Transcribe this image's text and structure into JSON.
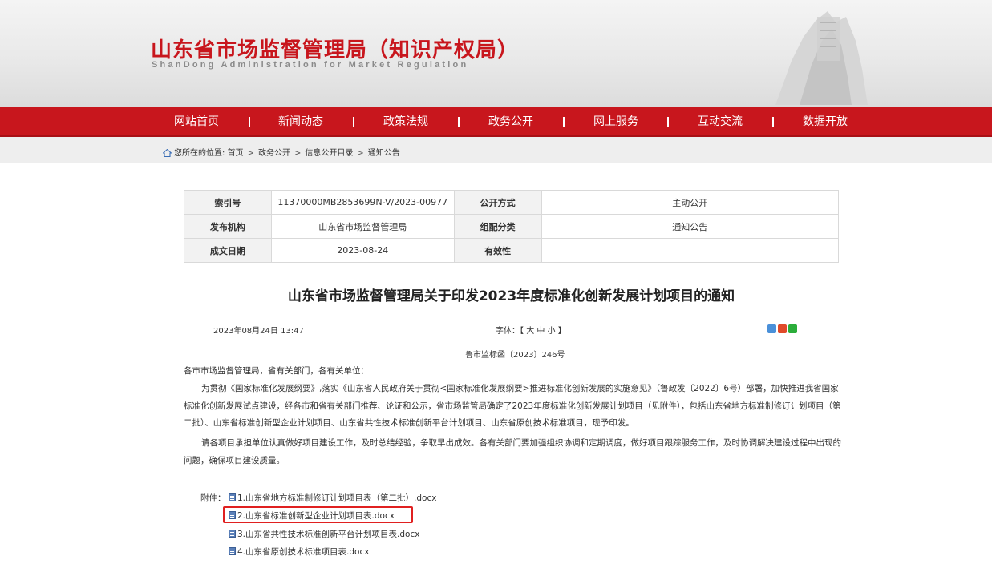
{
  "header": {
    "title": "山东省市场监督管理局（知识产权局）",
    "subtitle": "ShanDong Administration for Market Regulation",
    "brand_color": "#c8161d"
  },
  "nav": {
    "items": [
      "网站首页",
      "新闻动态",
      "政策法规",
      "政务公开",
      "网上服务",
      "互动交流",
      "数据开放"
    ]
  },
  "breadcrumb": {
    "prefix": "您所在的位置:",
    "items": [
      "首页",
      "政务公开",
      "信息公开目录",
      "通知公告"
    ]
  },
  "info_table": {
    "rows": [
      [
        {
          "k": "索引号",
          "v": "11370000MB2853699N-V/2023-00977"
        },
        {
          "k": "公开方式",
          "v": "主动公开"
        }
      ],
      [
        {
          "k": "发布机构",
          "v": "山东省市场监督管理局"
        },
        {
          "k": "组配分类",
          "v": "通知公告"
        }
      ],
      [
        {
          "k": "成文日期",
          "v": "2023-08-24"
        },
        {
          "k": "有效性",
          "v": ""
        }
      ]
    ]
  },
  "article": {
    "title": "山东省市场监督管理局关于印发2023年度标准化创新发展计划项目的通知",
    "datetime": "2023年08月24日 13:47",
    "font_label": "字体：【",
    "font_large": "大",
    "font_medium": "中",
    "font_small": "小",
    "font_close": "】",
    "doc_number": "鲁市监标函〔2023〕246号",
    "salutation": "各市市场监督管理局，省有关部门，各有关单位：",
    "paragraph1": "为贯彻《国家标准化发展纲要》,落实《山东省人民政府关于贯彻<国家标准化发展纲要>推进标准化创新发展的实施意见》（鲁政发〔2022〕6号）部署，加快推进我省国家标准化创新发展试点建设，经各市和省有关部门推荐、论证和公示，省市场监管局确定了2023年度标准化创新发展计划项目（见附件），包括山东省地方标准制修订计划项目（第二批）、山东省标准创新型企业计划项目、山东省共性技术标准创新平台计划项目、山东省原创技术标准项目，现予印发。",
    "paragraph2": "请各项目承担单位认真做好项目建设工作，及时总结经验，争取早出成效。各有关部门要加强组织协调和定期调度，做好项目跟踪服务工作，及时协调解决建设过程中出现的问题，确保项目建设质量。",
    "attachments_label": "附件：",
    "attachments": [
      "1.山东省地方标准制修订计划项目表（第二批）.docx",
      "2.山东省标准创新型企业计划项目表.docx",
      "3.山东省共性技术标准创新平台计划项目表.docx",
      "4.山东省原创技术标准项目表.docx"
    ],
    "highlighted_attachment": 1,
    "highlight_color": "#e02020"
  }
}
